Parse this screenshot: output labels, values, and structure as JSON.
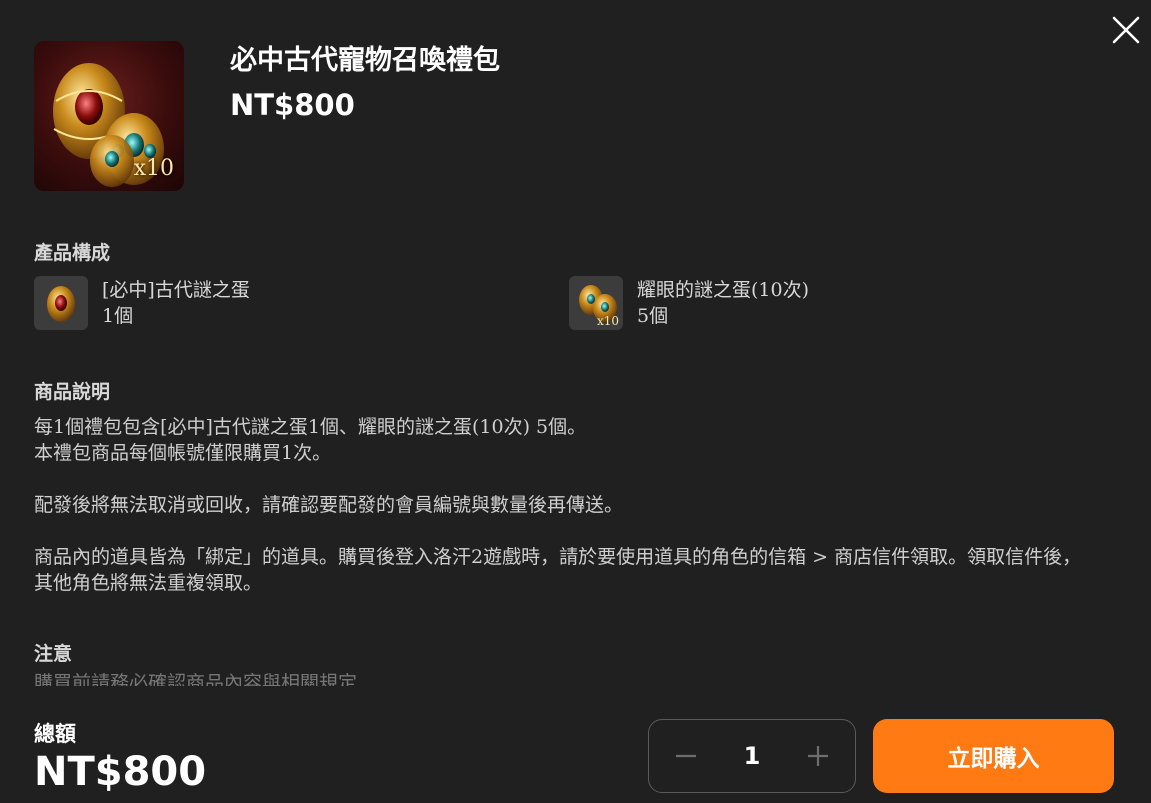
{
  "colors": {
    "background": "#202020",
    "accent": "#ff7a12",
    "text": "#ffffff"
  },
  "icons": {
    "close": "close-icon",
    "minus": "minus-icon",
    "plus": "plus-icon"
  },
  "product": {
    "title": "必中古代寵物召喚禮包",
    "price": "NT$800",
    "image_badge": "x10"
  },
  "composition": {
    "heading": "產品構成",
    "items": [
      {
        "name": "[必中]古代謎之蛋",
        "count": "1個"
      },
      {
        "name": "耀眼的謎之蛋(10次)",
        "count": "5個",
        "badge": "x10"
      }
    ]
  },
  "description": {
    "heading": "商品說明",
    "paragraphs": [
      "每1個禮包包含[必中]古代謎之蛋1個、耀眼的謎之蛋(10次) 5個。",
      "本禮包商品每個帳號僅限購買1次。",
      "配發後將無法取消或回收，請確認要配發的會員編號與數量後再傳送。",
      "商品內的道具皆為「綁定」的道具。購買後登入洛汗2遊戲時，請於要使用道具的角色的信箱 > 商店信件領取。領取信件後，其他角色將無法重複領取。"
    ]
  },
  "notice": {
    "heading": "注意",
    "partial_text": "購買前請務必確認商品內容與相關規定"
  },
  "footer": {
    "total_label": "總額",
    "total_value": "NT$800",
    "quantity": "1",
    "buy_label": "立即購入"
  }
}
